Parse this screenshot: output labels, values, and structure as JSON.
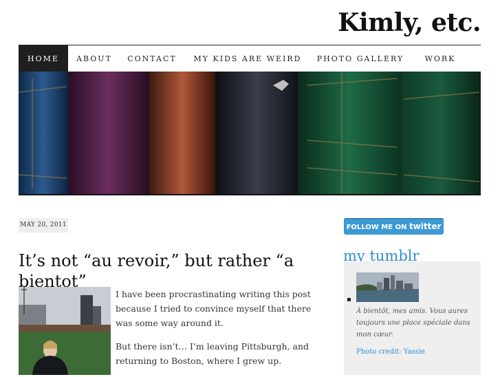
{
  "site": {
    "title": "Kimly, etc."
  },
  "nav": {
    "items": [
      {
        "label": "HOME"
      },
      {
        "label": "ABOUT"
      },
      {
        "label": "CONTACT"
      },
      {
        "label": "MY KIDS ARE WEIRD"
      },
      {
        "label": "PHOTO GALLERY"
      },
      {
        "label": "WORK"
      }
    ],
    "active_index": 0
  },
  "post": {
    "date": "MAY 20, 2011",
    "title": "It’s not “au revoir,” but rather “a bientot”",
    "paragraphs": [
      "I have been procrastinating writing this post because I tried to convince myself that there was some way around it.",
      "But there isn’t… I’m leaving Pittsburgh, and returning to Boston, where I grew up."
    ]
  },
  "sidebar": {
    "twitter_prefix": "FOLLOW ME ON",
    "twitter_brand": "twitter",
    "tumblr_heading": "my tumblr",
    "tumblr_caption": "À bientôt, mes amis. Vous aures toujours une place spéciale dans mon cœur.",
    "photo_credit_label": "Photo credit:",
    "photo_credit_name": "Yassie"
  },
  "colors": {
    "accent_blue": "#2a8fd1",
    "nav_active_bg": "#1f1f1f",
    "twitter_blue": "#3e9ad4"
  }
}
